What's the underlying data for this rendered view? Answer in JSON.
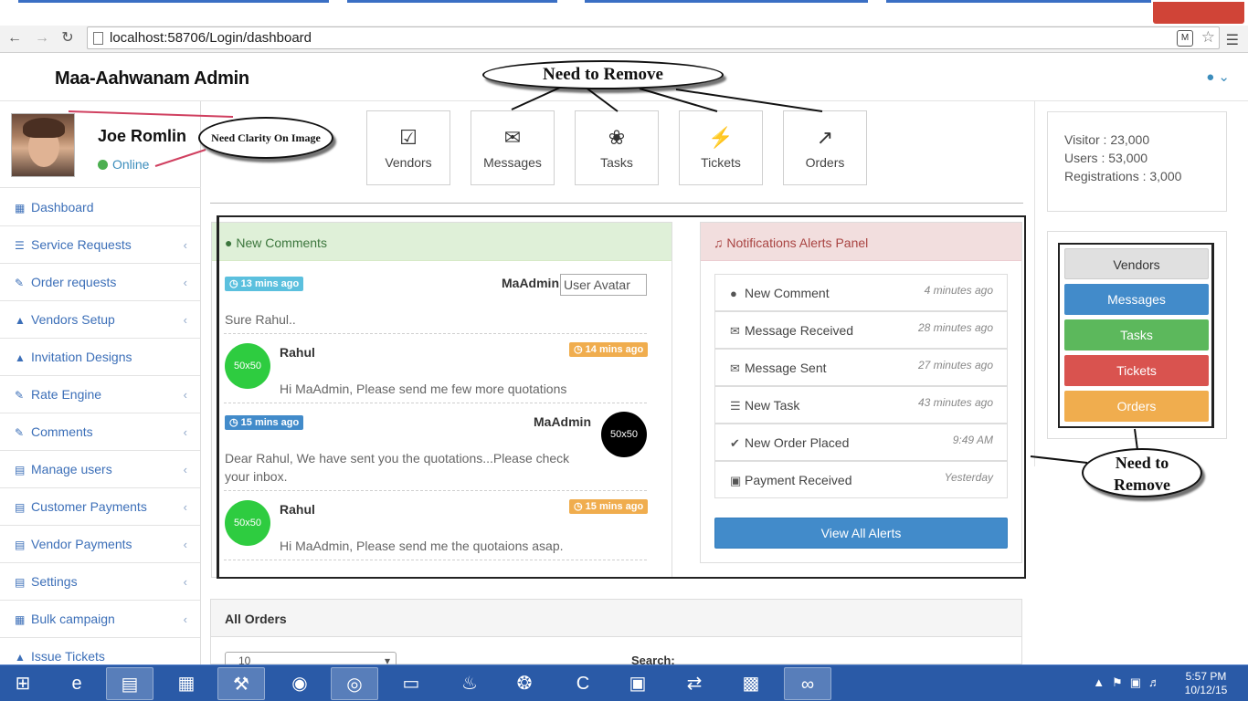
{
  "browser": {
    "url": "localhost:58706/Login/dashboard",
    "back_icon": "arrow-left-icon",
    "forward_icon": "arrow-right-icon",
    "reload_icon": "reload-icon"
  },
  "app": {
    "brand": "Maa-Aahwanam Admin",
    "accent": "#3c8dbc"
  },
  "profile": {
    "name": "Joe Romlin",
    "status": "Online"
  },
  "sidebar": {
    "items": [
      {
        "label": "Dashboard",
        "icon": "table-icon",
        "chev": ""
      },
      {
        "label": "Service Requests",
        "icon": "list-icon",
        "chev": "‹"
      },
      {
        "label": "Order requests",
        "icon": "pencil-icon",
        "chev": "‹"
      },
      {
        "label": "Vendors Setup",
        "icon": "warning-icon",
        "chev": "‹"
      },
      {
        "label": "Invitation Designs",
        "icon": "warning-icon",
        "chev": ""
      },
      {
        "label": "Rate Engine",
        "icon": "pencil-icon",
        "chev": "‹"
      },
      {
        "label": "Comments",
        "icon": "pencil-icon",
        "chev": "‹"
      },
      {
        "label": "Manage users",
        "icon": "bar-chart-icon",
        "chev": "‹"
      },
      {
        "label": "Customer Payments",
        "icon": "bar-chart-icon",
        "chev": "‹"
      },
      {
        "label": "Vendor Payments",
        "icon": "bar-chart-icon",
        "chev": "‹"
      },
      {
        "label": "Settings",
        "icon": "bar-chart-icon",
        "chev": "‹"
      },
      {
        "label": "Bulk campaign",
        "icon": "table-icon",
        "chev": "‹"
      },
      {
        "label": "Issue Tickets",
        "icon": "warning-icon",
        "chev": ""
      }
    ]
  },
  "tiles": [
    {
      "label": "Vendors",
      "icon": "checkbox-icon"
    },
    {
      "label": "Messages",
      "icon": "envelope-icon"
    },
    {
      "label": "Tasks",
      "icon": "leaf-icon"
    },
    {
      "label": "Tickets",
      "icon": "bolt-icon"
    },
    {
      "label": "Orders",
      "icon": "external-link-icon"
    }
  ],
  "comments": {
    "title": "New Comments",
    "items": [
      {
        "time": "13 mins ago",
        "name": "MaAdmin",
        "text": "Sure Rahul..",
        "avatar": "User Avatar"
      },
      {
        "time": "14 mins ago",
        "name": "Rahul",
        "text": "Hi MaAdmin, Please send me few more quotations",
        "avatar": "50x50"
      },
      {
        "time": "15 mins ago",
        "name": "MaAdmin",
        "text": "Dear Rahul, We have sent you the quotations...Please check your inbox.",
        "avatar": "50x50"
      },
      {
        "time": "15 mins ago",
        "name": "Rahul",
        "text": "Hi MaAdmin, Please send me the quotaions asap.",
        "avatar": "50x50"
      }
    ]
  },
  "notifications": {
    "title": "Notifications Alerts Panel",
    "items": [
      {
        "label": "New Comment",
        "time": "4 minutes ago",
        "icon": "comment-icon"
      },
      {
        "label": "Message Received",
        "time": "28 minutes ago",
        "icon": "envelope-icon"
      },
      {
        "label": "Message Sent",
        "time": "27 minutes ago",
        "icon": "envelope-icon"
      },
      {
        "label": "New Task",
        "time": "43 minutes ago",
        "icon": "tasks-icon"
      },
      {
        "label": "New Order Placed",
        "time": "9:49 AM",
        "icon": "check-icon"
      },
      {
        "label": "Payment Received",
        "time": "Yesterday",
        "icon": "money-icon"
      }
    ],
    "view_all": "View All Alerts"
  },
  "stats": {
    "visitor": "Visitor   : 23,000",
    "users": "Users   : 53,000",
    "registrations": "Registrations   : 3,000"
  },
  "quick_buttons": [
    {
      "label": "Vendors",
      "color": "#e0e0e0",
      "text_color": "#333333"
    },
    {
      "label": "Messages",
      "color": "#428bca",
      "text_color": "#ffffff"
    },
    {
      "label": "Tasks",
      "color": "#5cb85c",
      "text_color": "#ffffff"
    },
    {
      "label": "Tickets",
      "color": "#d9534f",
      "text_color": "#ffffff"
    },
    {
      "label": "Orders",
      "color": "#f0ad4e",
      "text_color": "#ffffff"
    }
  ],
  "orders": {
    "title": "All Orders",
    "length_value": "10",
    "search_label": "Search:"
  },
  "annotations": {
    "remove_top": "Need to Remove",
    "clarity": "Need Clarity On Image",
    "remove_right_1": "Need to",
    "remove_right_2": "Remove"
  },
  "taskbar": {
    "time": "5:57 PM",
    "date": "10/12/15"
  }
}
